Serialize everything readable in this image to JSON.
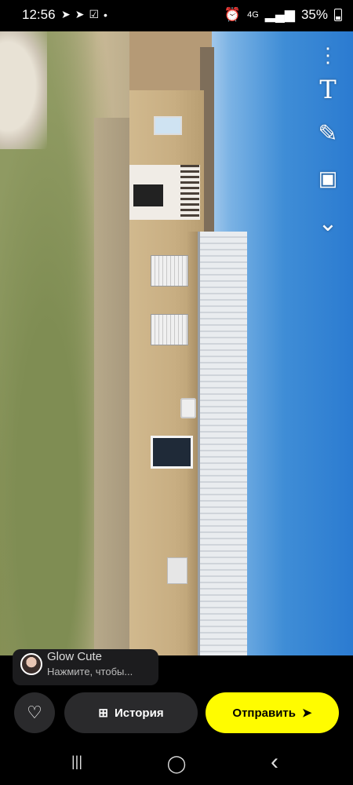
{
  "status_bar": {
    "time": "12:56",
    "network": "4G",
    "battery": "35%",
    "icons": [
      "telegram-icon",
      "telegram-icon",
      "check-box-icon",
      "dot-icon",
      "alarm-icon",
      "signal-icon",
      "battery-icon"
    ]
  },
  "tools": {
    "items": [
      {
        "name": "more-options-icon",
        "glyph": "⋮"
      },
      {
        "name": "text-tool-icon",
        "glyph": "T"
      },
      {
        "name": "pencil-icon",
        "glyph": "✎"
      },
      {
        "name": "sticker-icon",
        "glyph": "▣"
      },
      {
        "name": "chevron-down-icon",
        "glyph": "⌄"
      }
    ]
  },
  "profile": {
    "name": "Glow Cute",
    "hint": "Нажмите, чтобы..."
  },
  "actions": {
    "heart_icon": "♡",
    "story_label": "История",
    "story_icon": "⊞",
    "send_label": "Отправить",
    "send_icon": "➤"
  },
  "navigation": {
    "recent_glyph": "|||",
    "home_glyph": "◯",
    "back_glyph": "‹"
  },
  "colors": {
    "send_button": "#fffc00",
    "dark_button": "#2a2a2c"
  }
}
